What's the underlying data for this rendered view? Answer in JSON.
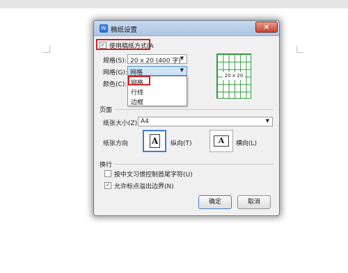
{
  "dialog": {
    "title": "稿纸设置",
    "close_label": "×",
    "use_format": {
      "label": "使用稿纸方式(A",
      "checked": true
    },
    "spec": {
      "label": "规格(S):",
      "value": "20 x 20 (400 字)"
    },
    "grid": {
      "label": "网格(G):",
      "value": "网格",
      "options": [
        "网格",
        "行线",
        "边框"
      ],
      "selected_option": "网格"
    },
    "color": {
      "label": "颜色(C):"
    },
    "preview": {
      "label": "20 x 20",
      "color": "#2f9a3b"
    },
    "page": {
      "section_title": "页面",
      "paper_size_label": "纸张大小(Z):",
      "paper_size_value": "A4",
      "orientation_label": "纸张方向",
      "portrait_label": "纵向(T)",
      "landscape_label": "横向(L)",
      "glyph": "A"
    },
    "wrap": {
      "section_title": "换行",
      "option1": {
        "label": "按中文习惯控制首尾字符(U)",
        "checked": false
      },
      "option2": {
        "label": "允许标点溢出边界(N)",
        "checked": true
      }
    },
    "buttons": {
      "ok": "确定",
      "cancel": "取消"
    }
  },
  "icons": {
    "check": "✓",
    "dropdown": "▼"
  },
  "colors": {
    "highlight": "#d11f26",
    "accent": "#3a7ed0"
  }
}
